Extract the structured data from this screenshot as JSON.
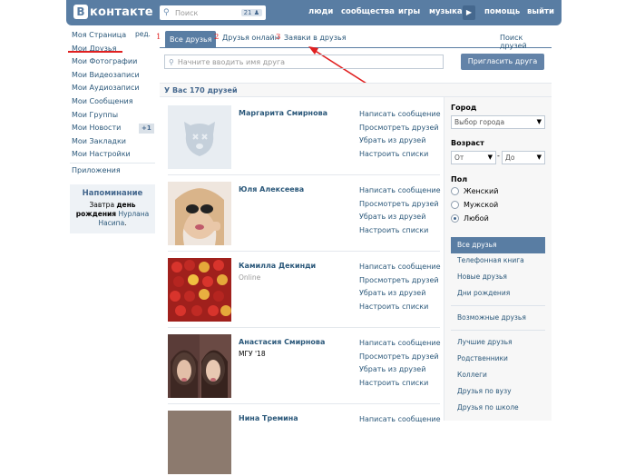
{
  "header": {
    "logo_letter": "В",
    "logo_text": "контакте",
    "search_placeholder": "Поиск",
    "search_count": "21",
    "nav": [
      "люди",
      "сообщества",
      "игры",
      "музыка",
      "помощь",
      "выйти"
    ]
  },
  "left_nav": {
    "items": [
      "Моя Страница",
      "Мои Друзья",
      "Мои Фотографии",
      "Мои Видеозаписи",
      "Мои Аудиозаписи",
      "Мои Сообщения",
      "Мои Группы",
      "Мои Новости",
      "Мои Закладки",
      "Мои Настройки"
    ],
    "edit_label": "ред.",
    "news_badge": "+1",
    "apps": "Приложения"
  },
  "reminder": {
    "title": "Напоминание",
    "text_prefix": "Завтра",
    "bold1": "день",
    "bold2": "рождения",
    "name": "Нурлана Насипа",
    "dot": "."
  },
  "annotations": [
    "1",
    "2",
    "3"
  ],
  "tabs": {
    "all": "Все друзья",
    "online": "Друзья онлайн",
    "requests": "Заявки в друзья",
    "search": "Поиск друзей"
  },
  "search_friends": {
    "placeholder": "Начните вводить имя друга",
    "invite_button": "Пригласить друга"
  },
  "count_label": "У Вас 170 друзей",
  "friends": [
    {
      "name": "Маргарита Смирнова",
      "sub": ""
    },
    {
      "name": "Юля Алексеева",
      "sub": ""
    },
    {
      "name": "Камилла Декинди",
      "sub": "Online"
    },
    {
      "name": "Анастасия Смирнова",
      "sub": "МГУ '18"
    },
    {
      "name": "Нина Тремина",
      "sub": ""
    }
  ],
  "friend_actions": [
    "Написать сообщение",
    "Просмотреть друзей",
    "Убрать из друзей",
    "Настроить списки"
  ],
  "filter": {
    "city_label": "Город",
    "city_select": "Выбор города",
    "age_label": "Возраст",
    "age_from": "От",
    "age_to": "До",
    "age_dash": "-",
    "sex_label": "Пол",
    "sex_options": [
      "Женский",
      "Мужской",
      "Любой"
    ],
    "sex_selected": 2,
    "lists_top": [
      "Все друзья",
      "Телефонная книга",
      "Новые друзья",
      "Дни рождения"
    ],
    "lists_mid": [
      "Возможные друзья"
    ],
    "lists_bottom": [
      "Лучшие друзья",
      "Родственники",
      "Коллеги",
      "Друзья по вузу",
      "Друзья по школе"
    ]
  },
  "colors": {
    "header": "#597da3",
    "link": "#2b587a",
    "annotation": "#e02020"
  }
}
